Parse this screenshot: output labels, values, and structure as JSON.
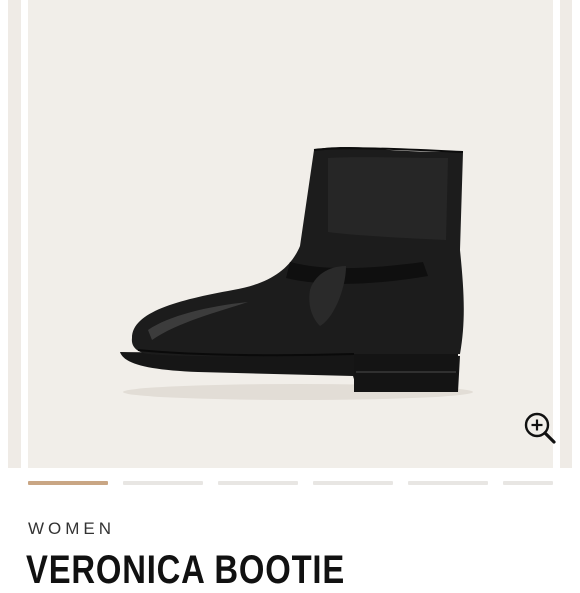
{
  "product": {
    "category": "WOMEN",
    "name": "VERONICA BOOTIE"
  },
  "gallery": {
    "image_subject": "black leather engineer bootie, side view",
    "zoom_icon": "zoom-in-icon",
    "active_index": 0,
    "dot_count": 6
  },
  "colors": {
    "image_bg": "#f1eee9",
    "active_indicator": "#c9a684",
    "inactive_indicator": "#e8e6e3"
  }
}
